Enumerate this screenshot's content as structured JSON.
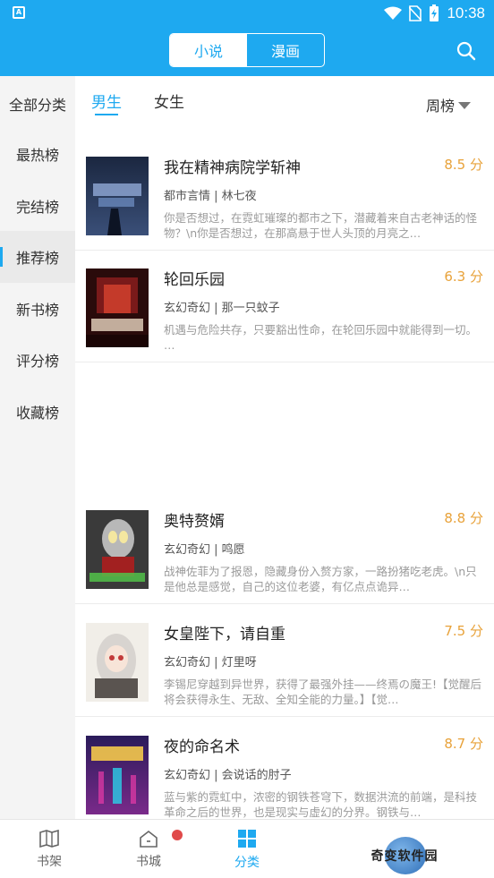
{
  "status": {
    "time": "10:38"
  },
  "header": {
    "tabs": [
      {
        "label": "小说",
        "active": true
      },
      {
        "label": "漫画",
        "active": false
      }
    ]
  },
  "sidebar": {
    "items": [
      {
        "label": "全部分类"
      },
      {
        "label": "最热榜"
      },
      {
        "label": "完结榜"
      },
      {
        "label": "推荐榜",
        "active": true
      },
      {
        "label": "新书榜"
      },
      {
        "label": "评分榜"
      },
      {
        "label": "收藏榜"
      }
    ]
  },
  "gender_tabs": [
    {
      "label": "男生",
      "active": true
    },
    {
      "label": "女生",
      "active": false
    }
  ],
  "period": {
    "label": "周榜"
  },
  "books": [
    {
      "title": "我在精神病院学斩神",
      "score": "8.5 分",
      "tags": "都市言情 | 林七夜",
      "desc": "你是否想过，在霓虹璀璨的都市之下，潜藏着来自古老神话的怪物？\\n你是否想过，在那高悬于世人头顶的月亮之…"
    },
    {
      "title": "轮回乐园",
      "score": "6.3 分",
      "tags": "玄幻奇幻 | 那一只蚊子",
      "desc": "机遇与危险共存，只要豁出性命，在轮回乐园中就能得到一切。 …"
    },
    {
      "title": "奥特赘婿",
      "score": "8.8 分",
      "tags": "玄幻奇幻 | 鸣愿",
      "desc": "战神佐菲为了报恩，隐藏身份入赘方家，一路扮猪吃老虎。\\n只是他总是感觉，自己的这位老婆，有亿点点诡异…"
    },
    {
      "title": "女皇陛下，请自重",
      "score": "7.5 分",
      "tags": "玄幻奇幻 | 灯里呀",
      "desc": "李锡尼穿越到异世界，获得了最强外挂——终焉の魔王!【觉醒后将会获得永生、无敌、全知全能的力量。】【觉…"
    },
    {
      "title": "夜的命名术",
      "score": "8.7 分",
      "tags": "玄幻奇幻 | 会说话的肘子",
      "desc": "蓝与紫的霓虹中，浓密的钢铁苍穹下，数据洪流的前端，是科技革命之后的世界，也是现实与虚幻的分界。钢铁与…"
    }
  ],
  "bottom_nav": [
    {
      "label": "书架"
    },
    {
      "label": "书城"
    },
    {
      "label": "分类",
      "active": true
    }
  ],
  "watermark": {
    "text": "奇变软件园"
  },
  "colors": {
    "accent": "#1ea9f0",
    "score": "#e8a23a",
    "badge": "#e04a4a"
  }
}
